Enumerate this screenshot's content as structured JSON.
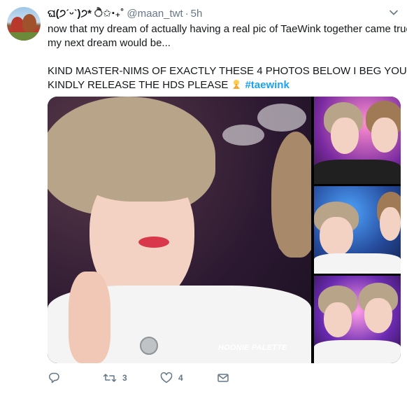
{
  "tweet": {
    "display_name": "ଘ(੭ˊᵕˋ)੭* ੈ✩‧₊˚",
    "handle": "@maan_twt",
    "separator": "·",
    "time": "5h",
    "text_lines": [
      "now that my dream of actually having a real pic of TaeWink together came true,",
      "my next dream would be...",
      "KIND MASTER-NIMS OF EXACTLY THESE 4 PHOTOS BELOW I BEG YOU",
      "KINDLY RELEASE THE HDS PLEASE"
    ],
    "hashtag": "#taewink",
    "watermark": "HOONIE PALETTE",
    "actions": {
      "replies": "",
      "retweets": "3",
      "likes": "4"
    }
  },
  "icons": {
    "reply": "reply-icon",
    "retweet": "retweet-icon",
    "like": "heart-icon",
    "dm": "envelope-icon",
    "caret": "chevron-down-icon",
    "emoji": "praying-emoji-icon"
  },
  "colors": {
    "link": "#1da1f2",
    "muted": "#657786",
    "text": "#14171a"
  }
}
